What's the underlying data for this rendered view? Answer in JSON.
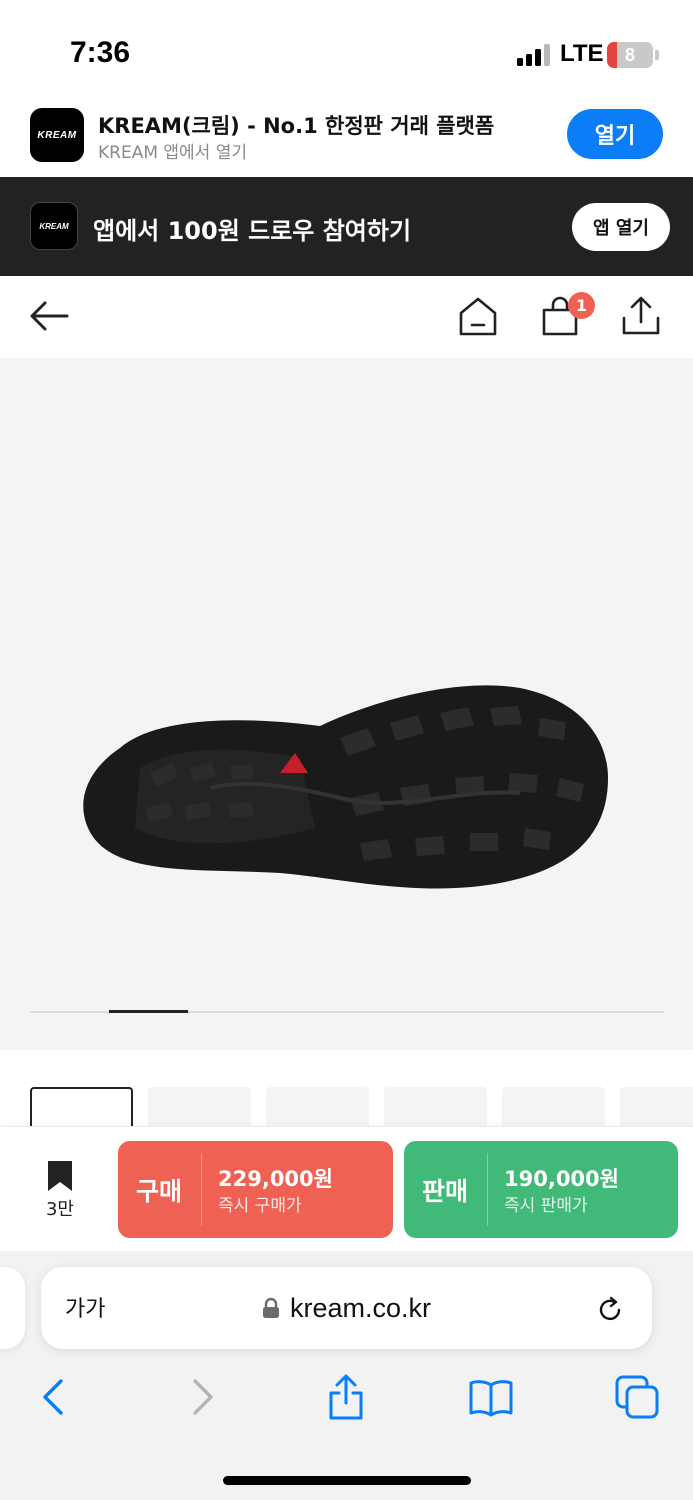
{
  "status_bar": {
    "time": "7:36",
    "network": "LTE",
    "battery": "8",
    "icons": [
      "signal-icon",
      "battery-icon"
    ]
  },
  "app_banner": {
    "logo_text": "KREAM",
    "title": "KREAM(크림) - No.1 한정판 거래 플랫폼",
    "subtitle": "KREAM 앱에서 열기",
    "open_label": "열기",
    "accent_color": "#0a7df7"
  },
  "promo_bar": {
    "logo_text": "KREAM",
    "text": "앱에서 100원 드로우 참여하기",
    "button_label": "앱 열기"
  },
  "nav": {
    "icons": [
      "back-arrow-icon",
      "home-icon",
      "shopping-bag-icon",
      "share-icon"
    ],
    "cart_count": "1"
  },
  "product": {
    "carousel_index": 2,
    "thumbnail_count": 6
  },
  "trade": {
    "wish_count": "3만",
    "buy": {
      "label": "구매",
      "price": "229,000원",
      "sub": "즉시 구매가",
      "color": "#ef6253"
    },
    "sell": {
      "label": "판매",
      "price": "190,000원",
      "sub": "즉시 판매가",
      "color": "#41b979"
    }
  },
  "browser": {
    "text_size_label": "가가",
    "url": "kream.co.kr",
    "icons": [
      "lock-icon",
      "reload-icon",
      "back-icon",
      "forward-icon",
      "share-icon",
      "bookmarks-icon",
      "tabs-icon"
    ],
    "accent_color": "#0a7df7"
  }
}
